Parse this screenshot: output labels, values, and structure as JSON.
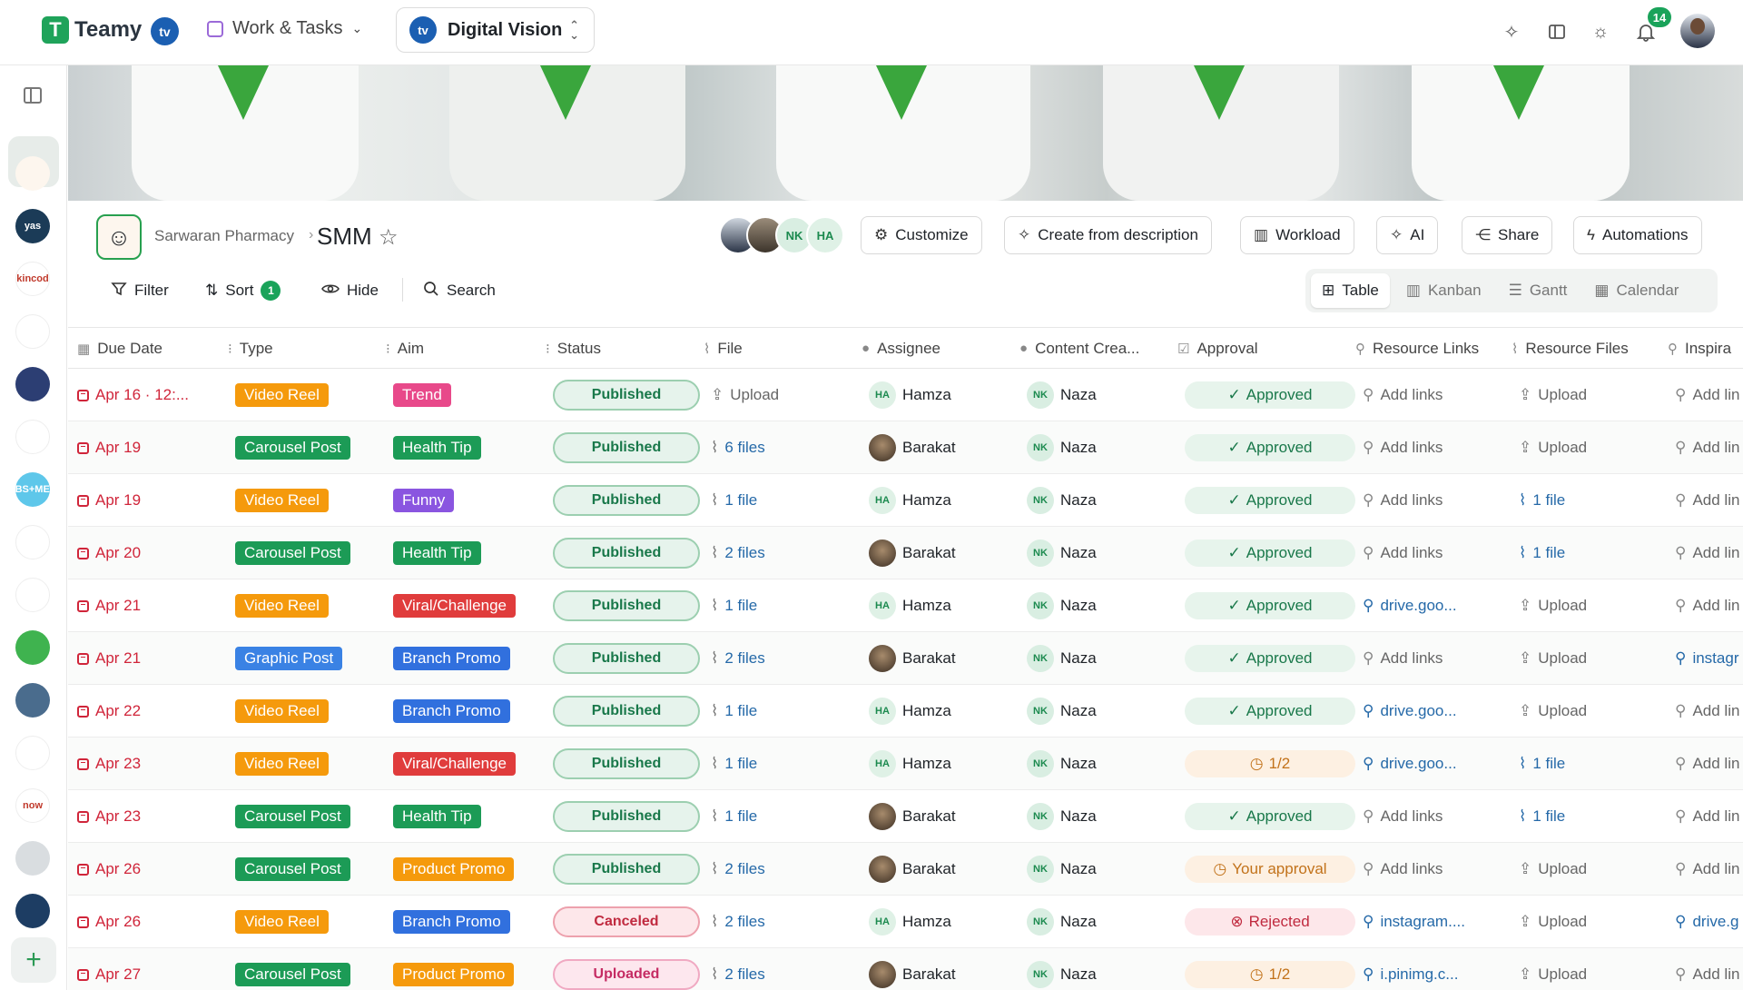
{
  "topbar": {
    "brand": "Teamy",
    "workspace_badge": "tv",
    "workspace_menu": "Work & Tasks",
    "project_selector": "Digital Vision",
    "notifications_count": "14"
  },
  "sidebar": {
    "items": [
      {
        "name": "sarwaran-pharmacy",
        "label": "",
        "bg": "#fdf6ee"
      },
      {
        "name": "yas",
        "label": "yas",
        "bg": "#1b3b57"
      },
      {
        "name": "skincode",
        "label": "skincode",
        "bg": "#ffffff"
      },
      {
        "name": "workspace-4",
        "label": "",
        "bg": "#ffffff"
      },
      {
        "name": "workspace-5",
        "label": "",
        "bg": "#2c3e73"
      },
      {
        "name": "workspace-6",
        "label": "",
        "bg": "#ffffff"
      },
      {
        "name": "sbs-med",
        "label": "SBS+MED",
        "bg": "#5ec7ea"
      },
      {
        "name": "workspace-8",
        "label": "",
        "bg": "#ffffff"
      },
      {
        "name": "workspace-9",
        "label": "",
        "bg": "#ffffff"
      },
      {
        "name": "workspace-10",
        "label": "",
        "bg": "#3fb34f"
      },
      {
        "name": "workspace-11",
        "label": "",
        "bg": "#4a6c8d"
      },
      {
        "name": "workspace-12",
        "label": "",
        "bg": "#ffffff"
      },
      {
        "name": "now",
        "label": "now",
        "bg": "#ffffff"
      },
      {
        "name": "workspace-14",
        "label": "",
        "bg": "#d9dde0"
      },
      {
        "name": "workspace-15",
        "label": "",
        "bg": "#1d3d63"
      }
    ]
  },
  "header": {
    "breadcrumb": "Sarwaran Pharmacy",
    "title": "SMM",
    "member_initials": [
      "NK",
      "HA"
    ],
    "buttons": {
      "customize": "Customize",
      "create_from_description": "Create from description",
      "workload": "Workload",
      "ai": "AI",
      "share": "Share",
      "automations": "Automations"
    }
  },
  "toolbar": {
    "filter": "Filter",
    "sort": "Sort",
    "sort_count": "1",
    "hide": "Hide",
    "search": "Search"
  },
  "views": [
    "Table",
    "Kanban",
    "Gantt",
    "Calendar"
  ],
  "table": {
    "columns": [
      "Due Date",
      "Type",
      "Aim",
      "Status",
      "File",
      "Assignee",
      "Content Crea...",
      "Approval",
      "Resource Links",
      "Resource Files",
      "Inspira"
    ],
    "rows": [
      {
        "due": "Apr 16 · 12:...",
        "type": "Video Reel",
        "aim": "Trend",
        "status": "Published",
        "file": "Upload",
        "assignee": "Hamza",
        "creator": "Naza",
        "approval": "Approved",
        "links": "Add links",
        "rfiles": "Upload",
        "insp": "Add lin"
      },
      {
        "due": "Apr 19",
        "type": "Carousel Post",
        "aim": "Health Tip",
        "status": "Published",
        "file": "6 files",
        "assignee": "Barakat",
        "creator": "Naza",
        "approval": "Approved",
        "links": "Add links",
        "rfiles": "Upload",
        "insp": "Add lin"
      },
      {
        "due": "Apr 19",
        "type": "Video Reel",
        "aim": "Funny",
        "status": "Published",
        "file": "1 file",
        "assignee": "Hamza",
        "creator": "Naza",
        "approval": "Approved",
        "links": "Add links",
        "rfiles": "1 file",
        "insp": "Add lin"
      },
      {
        "due": "Apr 20",
        "type": "Carousel Post",
        "aim": "Health Tip",
        "status": "Published",
        "file": "2 files",
        "assignee": "Barakat",
        "creator": "Naza",
        "approval": "Approved",
        "links": "Add links",
        "rfiles": "1 file",
        "insp": "Add lin"
      },
      {
        "due": "Apr 21",
        "type": "Video Reel",
        "aim": "Viral/Challenge",
        "status": "Published",
        "file": "1 file",
        "assignee": "Hamza",
        "creator": "Naza",
        "approval": "Approved",
        "links": "drive.goo...",
        "rfiles": "Upload",
        "insp": "Add lin"
      },
      {
        "due": "Apr 21",
        "type": "Graphic Post",
        "aim": "Branch Promo",
        "status": "Published",
        "file": "2 files",
        "assignee": "Barakat",
        "creator": "Naza",
        "approval": "Approved",
        "links": "Add links",
        "rfiles": "Upload",
        "insp": "instagr"
      },
      {
        "due": "Apr 22",
        "type": "Video Reel",
        "aim": "Branch Promo",
        "status": "Published",
        "file": "1 file",
        "assignee": "Hamza",
        "creator": "Naza",
        "approval": "Approved",
        "links": "drive.goo...",
        "rfiles": "Upload",
        "insp": "Add lin"
      },
      {
        "due": "Apr 23",
        "type": "Video Reel",
        "aim": "Viral/Challenge",
        "status": "Published",
        "file": "1 file",
        "assignee": "Hamza",
        "creator": "Naza",
        "approval": "1/2",
        "links": "drive.goo...",
        "rfiles": "1 file",
        "insp": "Add lin"
      },
      {
        "due": "Apr 23",
        "type": "Carousel Post",
        "aim": "Health Tip",
        "status": "Published",
        "file": "1 file",
        "assignee": "Barakat",
        "creator": "Naza",
        "approval": "Approved",
        "links": "Add links",
        "rfiles": "1 file",
        "insp": "Add lin"
      },
      {
        "due": "Apr 26",
        "type": "Carousel Post",
        "aim": "Product Promo",
        "status": "Published",
        "file": "2 files",
        "assignee": "Barakat",
        "creator": "Naza",
        "approval": "Your approval",
        "links": "Add links",
        "rfiles": "Upload",
        "insp": "Add lin"
      },
      {
        "due": "Apr 26",
        "type": "Video Reel",
        "aim": "Branch Promo",
        "status": "Canceled",
        "file": "2 files",
        "assignee": "Hamza",
        "creator": "Naza",
        "approval": "Rejected",
        "links": "instagram....",
        "rfiles": "Upload",
        "insp": "drive.g"
      },
      {
        "due": "Apr 27",
        "type": "Carousel Post",
        "aim": "Product Promo",
        "status": "Uploaded",
        "file": "2 files",
        "assignee": "Barakat",
        "creator": "Naza",
        "approval": "1/2",
        "links": "i.pinimg.c...",
        "rfiles": "Upload",
        "insp": "Add lin"
      }
    ]
  },
  "colors": {
    "brand_green": "#1aa35a",
    "due_red": "#d0253a",
    "type": {
      "Video Reel": "#f59a0c",
      "Carousel Post": "#1c9b56",
      "Graphic Post": "#3a82e4"
    },
    "aim": {
      "Trend": "#e8498a",
      "Health Tip": "#1c9b56",
      "Funny": "#8a55e0",
      "Viral/Challenge": "#e03c3c",
      "Branch Promo": "#3170de",
      "Product Promo": "#f59a0c"
    },
    "status": {
      "Published": [
        "#e6f3ec",
        "#9ccfb0",
        "#19784a"
      ],
      "Canceled": [
        "#fde7ea",
        "#eda1ad",
        "#c02a3f"
      ],
      "Uploaded": [
        "#fde7ee",
        "#f0a9c2",
        "#c52b63"
      ]
    },
    "approval": {
      "Approved": [
        "#e7f4ec",
        "#19784a"
      ],
      "1/2": [
        "#fdf0e2",
        "#c2721a"
      ],
      "Your approval": [
        "#fdf0e2",
        "#c2721a"
      ],
      "Rejected": [
        "#fde7ea",
        "#c02a3f"
      ]
    }
  }
}
